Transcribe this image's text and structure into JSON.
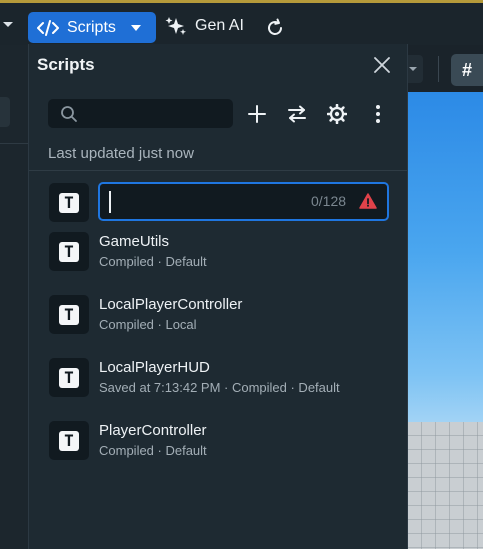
{
  "toolbar": {
    "scripts_tab_label": "Scripts",
    "gen_ai_label": "Gen AI",
    "grid_button_symbol": "#"
  },
  "panel": {
    "title": "Scripts",
    "search": {
      "value": "",
      "placeholder": ""
    },
    "actions": [
      "plus-icon",
      "swap-icon",
      "gear-icon",
      "more-vertical-icon"
    ],
    "status": "Last updated just now",
    "new_script": {
      "value": "",
      "counter": "0/128",
      "state": "warning"
    },
    "scripts": [
      {
        "name": "GameUtils",
        "meta": "Compiled · Default"
      },
      {
        "name": "LocalPlayerController",
        "meta": "Compiled · Local"
      },
      {
        "name": "LocalPlayerHUD",
        "meta": "Saved at 7:13:42 PM · Compiled · Default"
      },
      {
        "name": "PlayerController",
        "meta": "Compiled · Default"
      }
    ],
    "icon_glyph": "T"
  },
  "colors": {
    "accent": "#1f6fd6",
    "panel_bg": "#1e2a32",
    "input_bg": "#111a20",
    "warning": "#e0424a",
    "top_accent": "#b59a3a"
  }
}
